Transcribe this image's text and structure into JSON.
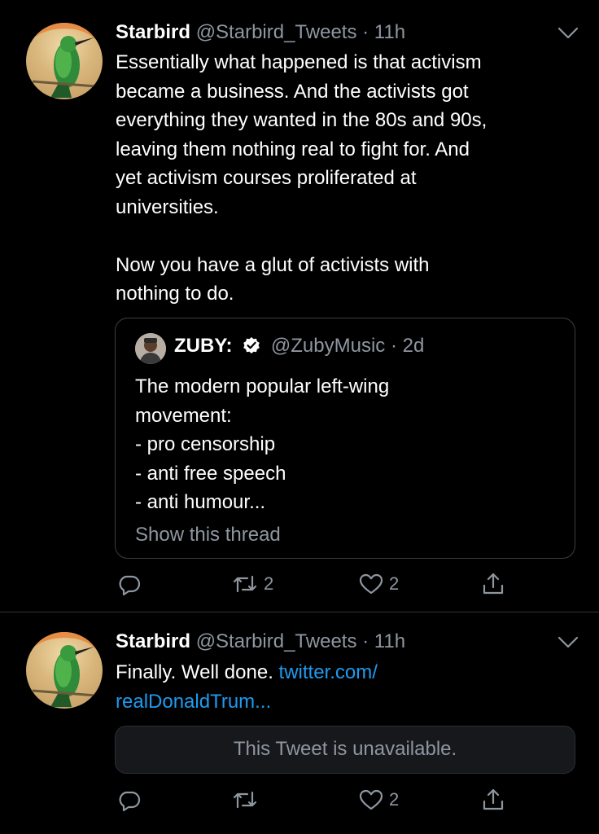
{
  "tweets": [
    {
      "author": "Starbird",
      "handle": "@Starbird_Tweets",
      "time": "· 11h",
      "lines": [
        "Essentially what happened is that activism",
        "became a business. And the activists got",
        "everything they wanted in the 80s and 90s,",
        "leaving them nothing real to fight for. And",
        "yet activism courses proliferated at",
        "universities.",
        "",
        "Now you have a glut of activists with",
        "nothing to do."
      ],
      "quote": {
        "author": "ZUBY:",
        "handle": "@ZubyMusic",
        "time": "· 2d",
        "lines": [
          "The modern popular left-wing",
          "movement:",
          "- pro censorship",
          "- anti free speech",
          "- anti humour..."
        ],
        "show_thread": "Show this thread"
      },
      "retweets": "2",
      "likes": "2"
    },
    {
      "author": "Starbird",
      "handle": "@Starbird_Tweets",
      "time": "· 11h",
      "text": "Finally. Well done. ",
      "link_line1": "twitter.com/",
      "link_line2": "realDonaldTrum...",
      "unavailable": "This Tweet is unavailable.",
      "retweets": "",
      "likes": "2"
    }
  ],
  "colors": {
    "background": "#000000",
    "secondary": "#8e96a0",
    "link": "#1d9bf0"
  },
  "icons": [
    "reply-icon",
    "retweet-icon",
    "like-icon",
    "share-icon",
    "chevron-down-icon",
    "verified-icon"
  ]
}
